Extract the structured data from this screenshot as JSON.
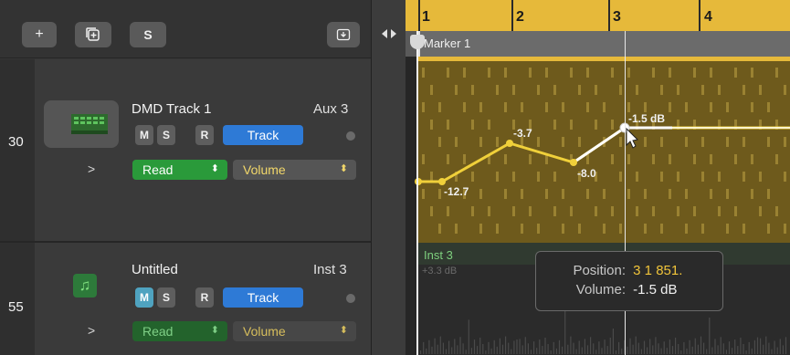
{
  "header_toolbar": {
    "add_label": "+",
    "solo_label": "S"
  },
  "tracks": [
    {
      "number": "30",
      "name": "DMD Track 1",
      "output": "Aux 3",
      "icon": "drum-machine-icon",
      "mute": "M",
      "solo": "S",
      "record": "R",
      "track_button": "Track",
      "automation_mode": "Read",
      "automation_param": "Volume"
    },
    {
      "number": "55",
      "name": "Untitled",
      "output": "Inst 3",
      "icon": "music-note-icon",
      "mute": "M",
      "solo": "S",
      "record": "R",
      "track_button": "Track",
      "automation_mode": "Read",
      "automation_param": "Volume"
    }
  ],
  "ruler": {
    "bars": [
      "1",
      "2",
      "3",
      "4"
    ]
  },
  "marker": {
    "label": "Marker 1"
  },
  "automation": {
    "points": [
      {
        "label": "",
        "value": null
      },
      {
        "label": "-12.7",
        "value": -12.7
      },
      {
        "label": "-3.7",
        "value": -3.7
      },
      {
        "label": "-8.0",
        "value": -8.0
      },
      {
        "label": "-1.5 dB",
        "value": -1.5
      }
    ]
  },
  "lower_region": {
    "name": "Inst 3",
    "value_label": "+3.3 dB"
  },
  "tooltip": {
    "position_label": "Position:",
    "position_value": "3 1 851.",
    "volume_label": "Volume:",
    "volume_value": "-1.5 dB"
  },
  "colors": {
    "ruler": "#e6b93a",
    "region": "#6e5a1c",
    "automation_line": "#f0d03a",
    "track_button": "#2e7ad6",
    "read_mode": "#2a9a3a",
    "solo_on": "#4fa3c0",
    "inst3_label": "#7ed07e"
  }
}
